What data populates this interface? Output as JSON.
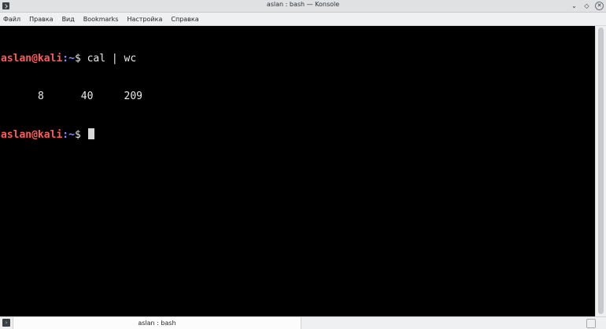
{
  "window": {
    "title": "aslan : bash — Konsole",
    "controls": {
      "minimize": "⌄",
      "keep_above": "◇",
      "close": "✕"
    }
  },
  "menu": [
    "Файл",
    "Правка",
    "Вид",
    "Bookmarks",
    "Настройка",
    "Справка"
  ],
  "terminal": {
    "line1": {
      "user_host": "aslan@kali",
      "path": ":~",
      "symbol": "$ ",
      "command": "cal | wc"
    },
    "line2": {
      "output": "      8      40     209"
    },
    "line3": {
      "user_host": "aslan@kali",
      "path": ":~",
      "symbol": "$ "
    }
  },
  "tabs": [
    {
      "label": "aslan : bash"
    }
  ],
  "colors": {
    "prompt_user": "#ff5a5a",
    "prompt_path": "#8a8cff",
    "terminal_bg": "#000000",
    "terminal_fg": "#e8e8e8"
  }
}
